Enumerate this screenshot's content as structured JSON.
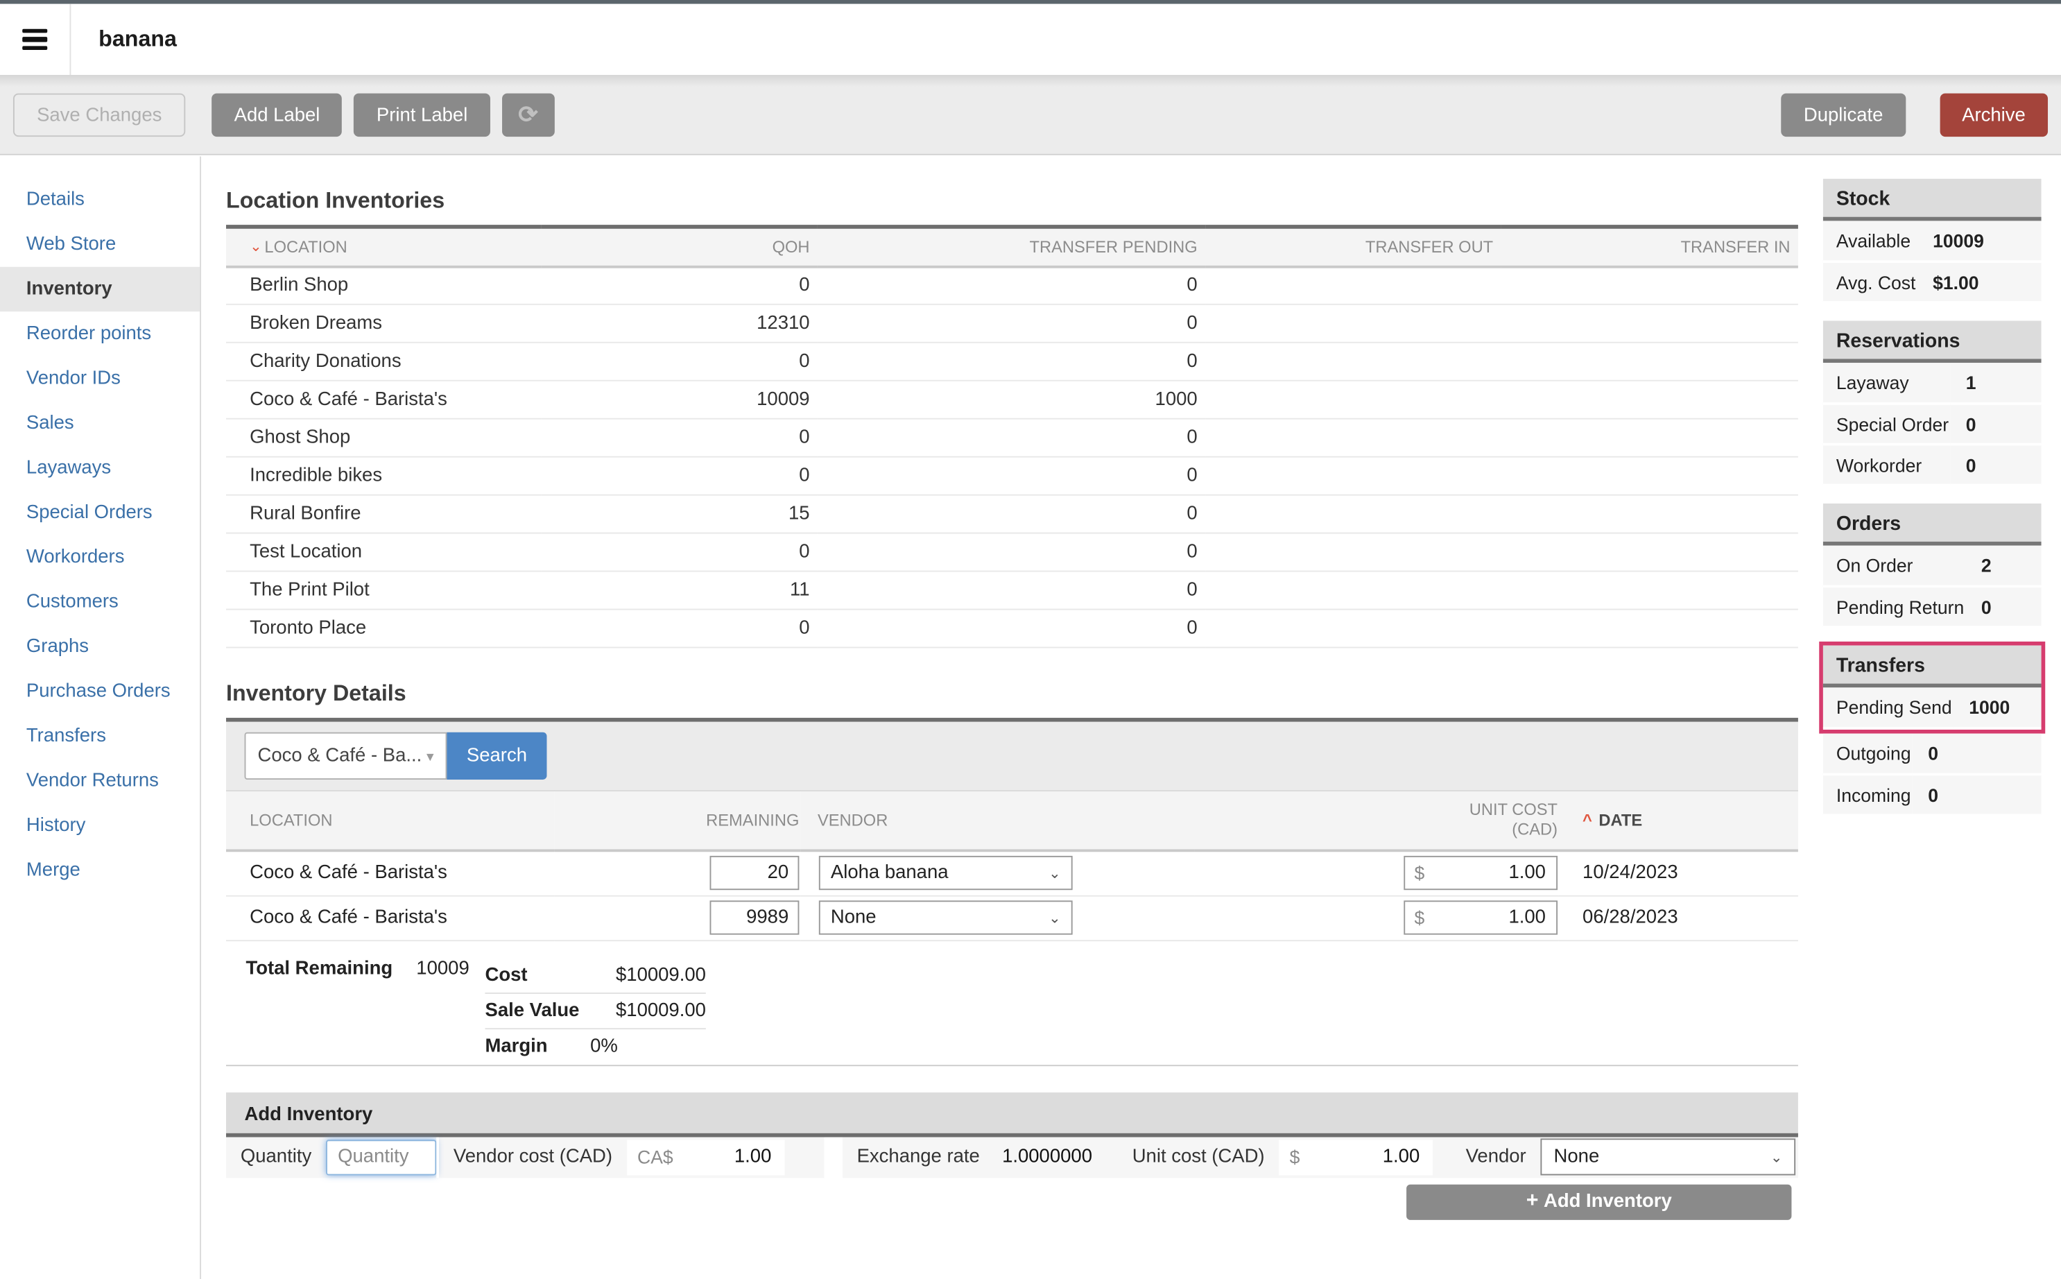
{
  "header": {
    "title": "banana"
  },
  "toolbar": {
    "save": "Save Changes",
    "add_label": "Add Label",
    "print_label": "Print Label",
    "duplicate": "Duplicate",
    "archive": "Archive"
  },
  "icons": {
    "refresh": "⟳",
    "sort_down": "⌄",
    "sort_up": "^",
    "select_caret": "▾",
    "chevron": "⌄",
    "plus": "+"
  },
  "sidebar": {
    "items": [
      "Details",
      "Web Store",
      "Inventory",
      "Reorder points",
      "Vendor IDs",
      "Sales",
      "Layaways",
      "Special Orders",
      "Workorders",
      "Customers",
      "Graphs",
      "Purchase Orders",
      "Transfers",
      "Vendor Returns",
      "History",
      "Merge"
    ]
  },
  "location_inventories": {
    "title": "Location Inventories",
    "columns": {
      "location": "LOCATION",
      "qoh": "QOH",
      "pending": "TRANSFER PENDING",
      "out": "TRANSFER OUT",
      "in": "TRANSFER IN"
    },
    "rows": [
      {
        "location": "Berlin Shop",
        "qoh": "0",
        "pending": "0",
        "out": "",
        "in": ""
      },
      {
        "location": "Broken Dreams",
        "qoh": "12310",
        "pending": "0",
        "out": "",
        "in": ""
      },
      {
        "location": "Charity Donations",
        "qoh": "0",
        "pending": "0",
        "out": "",
        "in": ""
      },
      {
        "location": "Coco & Café - Barista's",
        "qoh": "10009",
        "pending": "1000",
        "out": "",
        "in": ""
      },
      {
        "location": "Ghost Shop",
        "qoh": "0",
        "pending": "0",
        "out": "",
        "in": ""
      },
      {
        "location": "Incredible bikes",
        "qoh": "0",
        "pending": "0",
        "out": "",
        "in": ""
      },
      {
        "location": "Rural Bonfire",
        "qoh": "15",
        "pending": "0",
        "out": "",
        "in": ""
      },
      {
        "location": "Test Location",
        "qoh": "0",
        "pending": "0",
        "out": "",
        "in": ""
      },
      {
        "location": "The Print Pilot",
        "qoh": "11",
        "pending": "0",
        "out": "",
        "in": ""
      },
      {
        "location": "Toronto Place",
        "qoh": "0",
        "pending": "0",
        "out": "",
        "in": ""
      }
    ]
  },
  "inventory_details": {
    "title": "Inventory Details",
    "filter": {
      "select_value": "Coco & Café - Ba...",
      "search_label": "Search"
    },
    "columns": {
      "location": "LOCATION",
      "remaining": "REMAINING",
      "vendor": "VENDOR",
      "unit_cost_line1": "UNIT COST",
      "unit_cost_line2": "(CAD)",
      "date": "DATE"
    },
    "rows": [
      {
        "location": "Coco & Café - Barista's",
        "remaining": "20",
        "vendor": "Aloha banana",
        "currency": "$",
        "unit_cost": "1.00",
        "date": "10/24/2023"
      },
      {
        "location": "Coco & Café - Barista's",
        "remaining": "9989",
        "vendor": "None",
        "currency": "$",
        "unit_cost": "1.00",
        "date": "06/28/2023"
      }
    ],
    "totals": {
      "total_remaining_label": "Total Remaining",
      "total_remaining": "10009",
      "cost_label": "Cost",
      "cost": "$10009.00",
      "sale_value_label": "Sale Value",
      "sale_value": "$10009.00",
      "margin_label": "Margin",
      "margin": "0%"
    }
  },
  "add_inventory": {
    "title": "Add Inventory",
    "quantity_label": "Quantity",
    "quantity_placeholder": "Quantity",
    "quantity_value": "",
    "vendor_cost_label": "Vendor cost (CAD)",
    "vendor_cost_prefix": "CA$",
    "vendor_cost_value": "1.00",
    "exchange_label": "Exchange rate",
    "exchange_value": "1.0000000",
    "unit_cost_label": "Unit cost (CAD)",
    "unit_cost_prefix": "$",
    "unit_cost_value": "1.00",
    "vendor_label": "Vendor",
    "vendor_value": "None",
    "submit_label": "Add Inventory"
  },
  "right_panels": {
    "stock": {
      "title": "Stock",
      "rows": [
        {
          "label": "Available",
          "value": "10009"
        },
        {
          "label": "Avg. Cost",
          "value": "$1.00"
        }
      ]
    },
    "reservations": {
      "title": "Reservations",
      "rows": [
        {
          "label": "Layaway",
          "value": "1"
        },
        {
          "label": "Special Order",
          "value": "0"
        },
        {
          "label": "Workorder",
          "value": "0"
        }
      ]
    },
    "orders": {
      "title": "Orders",
      "rows": [
        {
          "label": "On Order",
          "value": "2"
        },
        {
          "label": "Pending Return",
          "value": "0"
        }
      ]
    },
    "transfers": {
      "title": "Transfers",
      "highlighted_rows": [
        {
          "label": "Pending Send",
          "value": "1000"
        }
      ],
      "rows": [
        {
          "label": "Outgoing",
          "value": "0"
        },
        {
          "label": "Incoming",
          "value": "0"
        }
      ]
    }
  },
  "colors": {
    "accent_blue": "#4c86c6",
    "link_blue": "#3a70a8",
    "archive_red": "#a4443b",
    "button_gray": "#8a8a8a",
    "highlight_pink": "#d63c6e",
    "sort_caret": "#e0563f"
  }
}
